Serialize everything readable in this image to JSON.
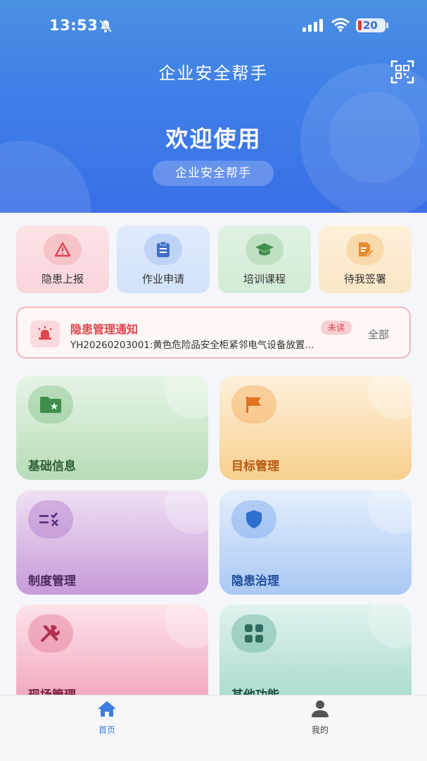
{
  "status_bar": {
    "time": "13:53",
    "battery": "20"
  },
  "header": {
    "app_title": "企业安全帮手",
    "welcome": "欢迎使用",
    "subtitle": "企业安全帮手"
  },
  "quick_actions": [
    {
      "label": "隐患上报",
      "icon": "warning-icon"
    },
    {
      "label": "作业申请",
      "icon": "clipboard-icon"
    },
    {
      "label": "培训课程",
      "icon": "graduation-cap-icon"
    },
    {
      "label": "待我签署",
      "icon": "sign-document-icon"
    }
  ],
  "notice": {
    "title": "隐患管理通知",
    "badge": "未读",
    "text": "YH20260203001:黄色危险品安全柜紧邻电气设备放置...",
    "all_label": "全部"
  },
  "modules": [
    {
      "label": "基础信息",
      "icon": "folder-star-icon"
    },
    {
      "label": "目标管理",
      "icon": "flag-icon"
    },
    {
      "label": "制度管理",
      "icon": "rules-check-icon"
    },
    {
      "label": "隐患治理",
      "icon": "shield-icon"
    },
    {
      "label": "现场管理",
      "icon": "tools-icon"
    },
    {
      "label": "其他功能",
      "icon": "grid-icon"
    }
  ],
  "tabbar": [
    {
      "label": "首页",
      "icon": "home-icon",
      "active": true
    },
    {
      "label": "我的",
      "icon": "user-icon",
      "active": false
    }
  ],
  "colors": {
    "primary": "#3d7be2",
    "alert": "#e0474d"
  }
}
